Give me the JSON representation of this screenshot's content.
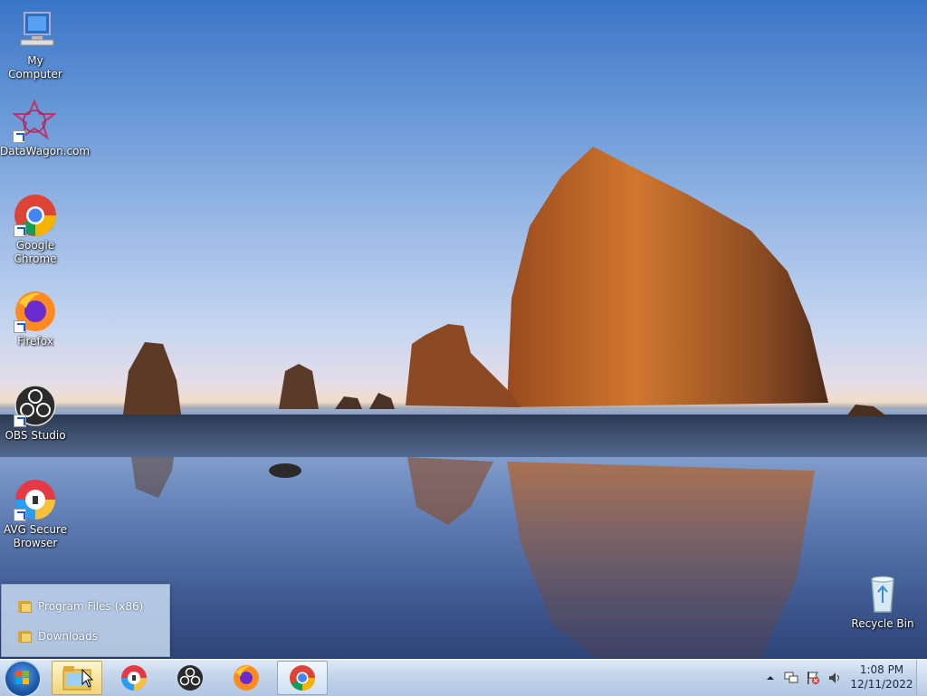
{
  "desktop": {
    "icons": [
      {
        "label": "My Computer",
        "icon": "computer-icon"
      },
      {
        "label": "DataWagon.com",
        "icon": "datawagon-icon"
      },
      {
        "label": "Google Chrome",
        "icon": "chrome-icon"
      },
      {
        "label": "Firefox",
        "icon": "firefox-icon"
      },
      {
        "label": "OBS Studio",
        "icon": "obs-icon"
      },
      {
        "label": "AVG Secure Browser",
        "icon": "avg-browser-icon"
      },
      {
        "label": "Recycle Bin",
        "icon": "recycle-bin-icon"
      }
    ]
  },
  "jumplist": {
    "items": [
      {
        "label": "Program Files (x86)",
        "icon": "folder-icon"
      },
      {
        "label": "Downloads",
        "icon": "folder-icon"
      }
    ]
  },
  "taskbar": {
    "pinned": [
      {
        "name": "explorer",
        "icon": "file-explorer-icon"
      },
      {
        "name": "avg",
        "icon": "avg-browser-icon"
      },
      {
        "name": "obs",
        "icon": "obs-icon"
      },
      {
        "name": "firefox",
        "icon": "firefox-icon"
      },
      {
        "name": "chrome",
        "icon": "chrome-icon"
      }
    ],
    "tray": {
      "time": "1:08 PM",
      "date": "12/11/2022"
    }
  },
  "colors": {
    "taskbar": "#c3d4ea",
    "accent": "#1c5aa8"
  }
}
